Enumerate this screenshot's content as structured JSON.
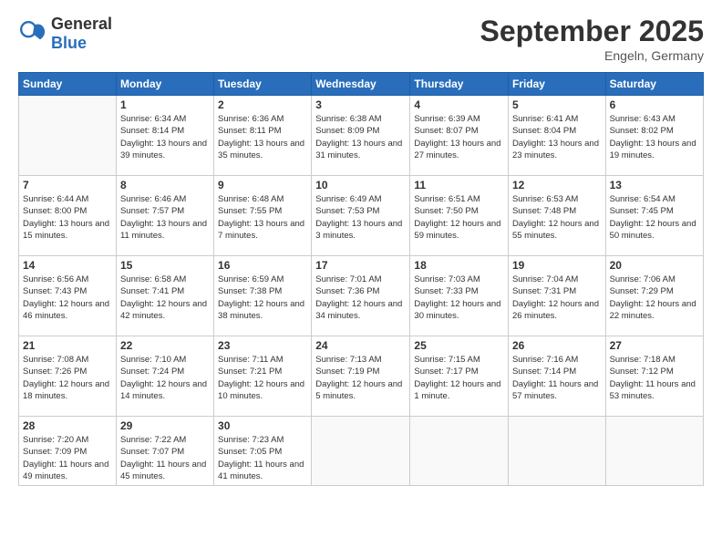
{
  "header": {
    "logo_general": "General",
    "logo_blue": "Blue",
    "title": "September 2025",
    "location": "Engeln, Germany"
  },
  "days_of_week": [
    "Sunday",
    "Monday",
    "Tuesday",
    "Wednesday",
    "Thursday",
    "Friday",
    "Saturday"
  ],
  "weeks": [
    [
      {
        "day": "",
        "info": ""
      },
      {
        "day": "1",
        "info": "Sunrise: 6:34 AM\nSunset: 8:14 PM\nDaylight: 13 hours\nand 39 minutes."
      },
      {
        "day": "2",
        "info": "Sunrise: 6:36 AM\nSunset: 8:11 PM\nDaylight: 13 hours\nand 35 minutes."
      },
      {
        "day": "3",
        "info": "Sunrise: 6:38 AM\nSunset: 8:09 PM\nDaylight: 13 hours\nand 31 minutes."
      },
      {
        "day": "4",
        "info": "Sunrise: 6:39 AM\nSunset: 8:07 PM\nDaylight: 13 hours\nand 27 minutes."
      },
      {
        "day": "5",
        "info": "Sunrise: 6:41 AM\nSunset: 8:04 PM\nDaylight: 13 hours\nand 23 minutes."
      },
      {
        "day": "6",
        "info": "Sunrise: 6:43 AM\nSunset: 8:02 PM\nDaylight: 13 hours\nand 19 minutes."
      }
    ],
    [
      {
        "day": "7",
        "info": "Sunrise: 6:44 AM\nSunset: 8:00 PM\nDaylight: 13 hours\nand 15 minutes."
      },
      {
        "day": "8",
        "info": "Sunrise: 6:46 AM\nSunset: 7:57 PM\nDaylight: 13 hours\nand 11 minutes."
      },
      {
        "day": "9",
        "info": "Sunrise: 6:48 AM\nSunset: 7:55 PM\nDaylight: 13 hours\nand 7 minutes."
      },
      {
        "day": "10",
        "info": "Sunrise: 6:49 AM\nSunset: 7:53 PM\nDaylight: 13 hours\nand 3 minutes."
      },
      {
        "day": "11",
        "info": "Sunrise: 6:51 AM\nSunset: 7:50 PM\nDaylight: 12 hours\nand 59 minutes."
      },
      {
        "day": "12",
        "info": "Sunrise: 6:53 AM\nSunset: 7:48 PM\nDaylight: 12 hours\nand 55 minutes."
      },
      {
        "day": "13",
        "info": "Sunrise: 6:54 AM\nSunset: 7:45 PM\nDaylight: 12 hours\nand 50 minutes."
      }
    ],
    [
      {
        "day": "14",
        "info": "Sunrise: 6:56 AM\nSunset: 7:43 PM\nDaylight: 12 hours\nand 46 minutes."
      },
      {
        "day": "15",
        "info": "Sunrise: 6:58 AM\nSunset: 7:41 PM\nDaylight: 12 hours\nand 42 minutes."
      },
      {
        "day": "16",
        "info": "Sunrise: 6:59 AM\nSunset: 7:38 PM\nDaylight: 12 hours\nand 38 minutes."
      },
      {
        "day": "17",
        "info": "Sunrise: 7:01 AM\nSunset: 7:36 PM\nDaylight: 12 hours\nand 34 minutes."
      },
      {
        "day": "18",
        "info": "Sunrise: 7:03 AM\nSunset: 7:33 PM\nDaylight: 12 hours\nand 30 minutes."
      },
      {
        "day": "19",
        "info": "Sunrise: 7:04 AM\nSunset: 7:31 PM\nDaylight: 12 hours\nand 26 minutes."
      },
      {
        "day": "20",
        "info": "Sunrise: 7:06 AM\nSunset: 7:29 PM\nDaylight: 12 hours\nand 22 minutes."
      }
    ],
    [
      {
        "day": "21",
        "info": "Sunrise: 7:08 AM\nSunset: 7:26 PM\nDaylight: 12 hours\nand 18 minutes."
      },
      {
        "day": "22",
        "info": "Sunrise: 7:10 AM\nSunset: 7:24 PM\nDaylight: 12 hours\nand 14 minutes."
      },
      {
        "day": "23",
        "info": "Sunrise: 7:11 AM\nSunset: 7:21 PM\nDaylight: 12 hours\nand 10 minutes."
      },
      {
        "day": "24",
        "info": "Sunrise: 7:13 AM\nSunset: 7:19 PM\nDaylight: 12 hours\nand 5 minutes."
      },
      {
        "day": "25",
        "info": "Sunrise: 7:15 AM\nSunset: 7:17 PM\nDaylight: 12 hours\nand 1 minute."
      },
      {
        "day": "26",
        "info": "Sunrise: 7:16 AM\nSunset: 7:14 PM\nDaylight: 11 hours\nand 57 minutes."
      },
      {
        "day": "27",
        "info": "Sunrise: 7:18 AM\nSunset: 7:12 PM\nDaylight: 11 hours\nand 53 minutes."
      }
    ],
    [
      {
        "day": "28",
        "info": "Sunrise: 7:20 AM\nSunset: 7:09 PM\nDaylight: 11 hours\nand 49 minutes."
      },
      {
        "day": "29",
        "info": "Sunrise: 7:22 AM\nSunset: 7:07 PM\nDaylight: 11 hours\nand 45 minutes."
      },
      {
        "day": "30",
        "info": "Sunrise: 7:23 AM\nSunset: 7:05 PM\nDaylight: 11 hours\nand 41 minutes."
      },
      {
        "day": "",
        "info": ""
      },
      {
        "day": "",
        "info": ""
      },
      {
        "day": "",
        "info": ""
      },
      {
        "day": "",
        "info": ""
      }
    ]
  ]
}
